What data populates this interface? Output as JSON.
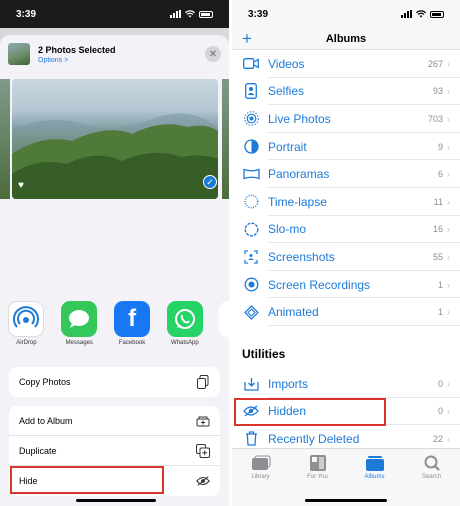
{
  "left": {
    "status": {
      "time": "3:39"
    },
    "share_header": {
      "title": "2 Photos Selected",
      "subtitle": "Options >",
      "close_glyph": "✕"
    },
    "apps": [
      {
        "label": "AirDrop",
        "icon": "airdrop-icon"
      },
      {
        "label": "Messages",
        "icon": "messages-icon"
      },
      {
        "label": "Facebook",
        "icon": "facebook-icon"
      },
      {
        "label": "WhatsApp",
        "icon": "whatsapp-icon"
      }
    ],
    "actions": {
      "copy_photos": "Copy Photos",
      "add_to_album": "Add to Album",
      "duplicate": "Duplicate",
      "hide": "Hide"
    }
  },
  "right": {
    "status": {
      "time": "3:39"
    },
    "nav": {
      "title": "Albums",
      "add_glyph": "+"
    },
    "media_types": [
      {
        "name": "Videos",
        "count": "267",
        "icon": "video-icon"
      },
      {
        "name": "Selfies",
        "count": "93",
        "icon": "selfie-icon"
      },
      {
        "name": "Live Photos",
        "count": "703",
        "icon": "live-photo-icon"
      },
      {
        "name": "Portrait",
        "count": "9",
        "icon": "portrait-icon"
      },
      {
        "name": "Panoramas",
        "count": "6",
        "icon": "panorama-icon"
      },
      {
        "name": "Time-lapse",
        "count": "11",
        "icon": "time-lapse-icon"
      },
      {
        "name": "Slo-mo",
        "count": "16",
        "icon": "slo-mo-icon"
      },
      {
        "name": "Screenshots",
        "count": "55",
        "icon": "screenshot-icon"
      },
      {
        "name": "Screen Recordings",
        "count": "1",
        "icon": "screen-recording-icon"
      },
      {
        "name": "Animated",
        "count": "1",
        "icon": "animated-icon"
      }
    ],
    "utilities_header": "Utilities",
    "utilities": [
      {
        "name": "Imports",
        "count": "0",
        "icon": "import-icon"
      },
      {
        "name": "Hidden",
        "count": "0",
        "icon": "hidden-eye-icon"
      },
      {
        "name": "Recently Deleted",
        "count": "22",
        "icon": "trash-icon"
      }
    ],
    "tabs": [
      {
        "label": "Library",
        "active": false
      },
      {
        "label": "For You",
        "active": false
      },
      {
        "label": "Albums",
        "active": true
      },
      {
        "label": "Search",
        "active": false
      }
    ]
  },
  "colors": {
    "accent": "#1d7bd8",
    "highlight_box": "#d9362b"
  }
}
